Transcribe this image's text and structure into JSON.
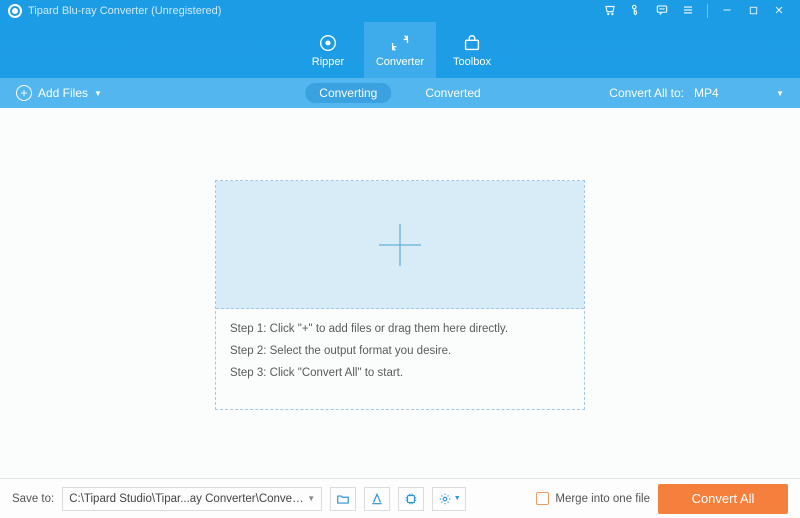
{
  "titlebar": {
    "title": "Tipard Blu-ray Converter (Unregistered)"
  },
  "header_tabs": {
    "ripper": "Ripper",
    "converter": "Converter",
    "toolbox": "Toolbox"
  },
  "subbar": {
    "add_files": "Add Files",
    "converting": "Converting",
    "converted": "Converted",
    "convert_all_to": "Convert All to:",
    "selected_format": "MP4"
  },
  "dropzone": {
    "step1": "Step 1: Click \"+\" to add files or drag them here directly.",
    "step2": "Step 2: Select the output format you desire.",
    "step3": "Step 3: Click \"Convert All\" to start."
  },
  "footer": {
    "save_to_label": "Save to:",
    "save_path": "C:\\Tipard Studio\\Tipar...ay Converter\\Converted",
    "merge_label": "Merge into one file",
    "convert_all_btn": "Convert All"
  },
  "colors": {
    "brand_blue": "#1d9ce6",
    "brand_blue_light": "#53b6ee",
    "accent_orange": "#f57f3c"
  }
}
